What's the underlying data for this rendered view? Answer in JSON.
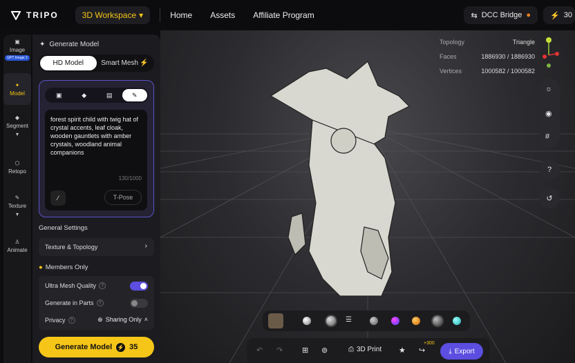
{
  "brand": {
    "name": "TRIPO"
  },
  "workspace": {
    "label": "3D Workspace"
  },
  "nav": {
    "home": "Home",
    "assets": "Assets",
    "affiliate": "Affiliate Program"
  },
  "topright": {
    "dcc": "DCC Bridge",
    "credits": "30"
  },
  "rail": {
    "image": "Image",
    "image_badge": "GPT Image 2",
    "model": "Model",
    "segment": "Segment",
    "retopo": "Retopo",
    "texture": "Texture",
    "animate": "Animate"
  },
  "panel": {
    "title": "Generate Model",
    "hd_model": "HD Model",
    "smart_mesh": "Smart Mesh",
    "prompt": "forest spirit child with twig hat of crystal accents, leaf cloak, wooden gauntlets with amber crystals, woodland animal companions",
    "count": "130/1000",
    "tpose": "T-Pose",
    "general_settings": "General Settings",
    "texture_topology": "Texture & Topology",
    "members_only": "Members Only",
    "ultra_mesh": "Ultra Mesh Quality",
    "ultra_mesh_on": true,
    "parts": "Generate in Parts",
    "parts_on": false,
    "privacy": "Privacy",
    "sharing": "Sharing Only",
    "generate": "Generate Model",
    "generate_cost": "35"
  },
  "stats": {
    "topology_label": "Topology",
    "topology": "Triangle",
    "faces_label": "Faces",
    "faces": "1886930 / 1886930",
    "vertices_label": "Vertices",
    "vertices": "1000582 / 1000582"
  },
  "bottom": {
    "print": "3D Print",
    "bonus": "+300",
    "export": "Export"
  },
  "colors": {
    "accent": "#f5c518",
    "purple": "#5b4ee0"
  }
}
